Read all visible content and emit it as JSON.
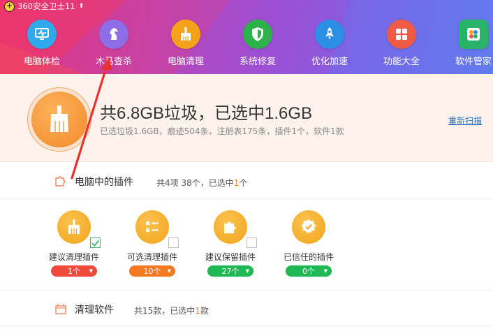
{
  "app": {
    "title": "360安全卫士11",
    "logo_glyph": "+",
    "update_arrow": "⬆"
  },
  "nav": [
    {
      "label": "电脑体检",
      "icon": "monitor-check-icon",
      "color": "#2fa8ec"
    },
    {
      "label": "木马查杀",
      "icon": "horse-icon",
      "color": "#8d6ee6"
    },
    {
      "label": "电脑清理",
      "icon": "broom-icon",
      "color": "#f3a21a"
    },
    {
      "label": "系统修复",
      "icon": "shield-icon",
      "color": "#2db24a"
    },
    {
      "label": "优化加速",
      "icon": "rocket-icon",
      "color": "#2b8fe6"
    },
    {
      "label": "功能大全",
      "icon": "grid-icon",
      "color": "#ef5a46"
    },
    {
      "label": "软件管家",
      "icon": "software-icon",
      "color": "#29b36a"
    }
  ],
  "summary": {
    "title": "共6.8GB垃圾，已选中1.6GB",
    "subtitle": "已选垃圾1.6GB，痕迹504条，注册表175条，插件1个，软件1款",
    "rescan": "重新扫描"
  },
  "plugins_section": {
    "title": "电脑中的插件",
    "count_prefix": "共4项 38个，已选中",
    "count_selected": "1",
    "count_suffix": "个"
  },
  "plugins": [
    {
      "label": "建议清理插件",
      "count": "1个",
      "checked": true,
      "color": "#ef4b3c",
      "icon": "broom-icon"
    },
    {
      "label": "可选清理插件",
      "count": "10个",
      "checked": false,
      "color": "#f47920",
      "icon": "list-icon"
    },
    {
      "label": "建议保留插件",
      "count": "27个",
      "checked": false,
      "color": "#1eb954",
      "icon": "puzzle-icon"
    },
    {
      "label": "已信任的插件",
      "count": "0个",
      "checked": false,
      "color": "#1eb954",
      "icon": "trusted-badge-icon"
    }
  ],
  "software_section": {
    "title": "清理软件",
    "count_prefix": "共15款，已选中",
    "count_selected": "1",
    "count_suffix": "款"
  },
  "colors": {
    "accent_orange": "#f47920",
    "link_blue": "#2f6fb8",
    "annotation_red": "#e8322d"
  }
}
